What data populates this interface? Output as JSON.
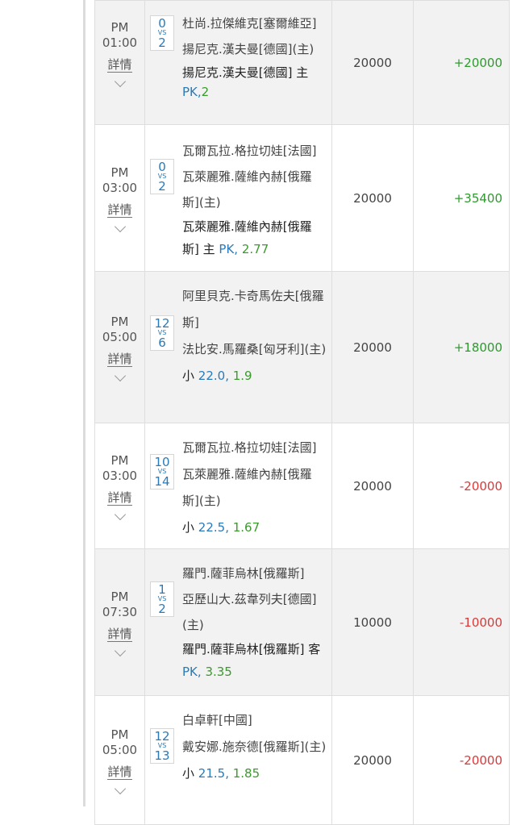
{
  "detail_label": "詳情",
  "vs_label": "VS",
  "colors": {
    "win": "#2e9a2e",
    "lose": "#d83a3a",
    "odds": "#2a7ab8",
    "price": "#3a9a2c"
  },
  "rows": [
    {
      "ampm": "PM",
      "time": "01:00",
      "score_home": "0",
      "score_away": "2",
      "team1": "杜尚.拉傑維克[塞爾維亞]",
      "team2": "揚尼克.漢夫曼[德國](主)",
      "pick": "揚尼克.漢夫曼[德國] 主",
      "pick_line": "PK,",
      "pick_price": "2",
      "stake": "20000",
      "result": "+20000"
    },
    {
      "ampm": "PM",
      "time": "03:00",
      "score_home": "0",
      "score_away": "2",
      "team1": "瓦爾瓦拉.格拉切娃[法國]",
      "team2": "瓦萊麗雅.薩維內赫[俄羅斯](主)",
      "pick": "瓦萊麗雅.薩維內赫[俄羅斯] 主",
      "pick_line": "PK,",
      "pick_price": "2.77",
      "stake": "20000",
      "result": "+35400"
    },
    {
      "ampm": "PM",
      "time": "05:00",
      "score_home": "12",
      "score_away": "6",
      "team1": "阿里貝克.卡奇馬佐夫[俄羅斯]",
      "team2": "法比安.馬羅桑[匈牙利](主)",
      "pick": "小",
      "pick_line": "22.0,",
      "pick_price": "1.9",
      "stake": "20000",
      "result": "+18000"
    },
    {
      "ampm": "PM",
      "time": "03:00",
      "score_home": "10",
      "score_away": "14",
      "team1": "瓦爾瓦拉.格拉切娃[法國]",
      "team2": "瓦萊麗雅.薩維內赫[俄羅斯](主)",
      "pick": "小",
      "pick_line": "22.5,",
      "pick_price": "1.67",
      "stake": "20000",
      "result": "-20000"
    },
    {
      "ampm": "PM",
      "time": "07:30",
      "score_home": "1",
      "score_away": "2",
      "team1": "羅門.薩菲烏林[俄羅斯]",
      "team2": "亞歷山大.茲韋列夫[德國](主)",
      "pick": "羅門.薩菲烏林[俄羅斯] 客",
      "pick_line": "PK,",
      "pick_price": "3.35",
      "stake": "10000",
      "result": "-10000"
    },
    {
      "ampm": "PM",
      "time": "05:00",
      "score_home": "12",
      "score_away": "13",
      "team1": "白卓軒[中國]",
      "team2": "戴安娜.施奈德[俄羅斯](主)",
      "pick": "小",
      "pick_line": "21.5,",
      "pick_price": "1.85",
      "stake": "20000",
      "result": "-20000"
    }
  ]
}
